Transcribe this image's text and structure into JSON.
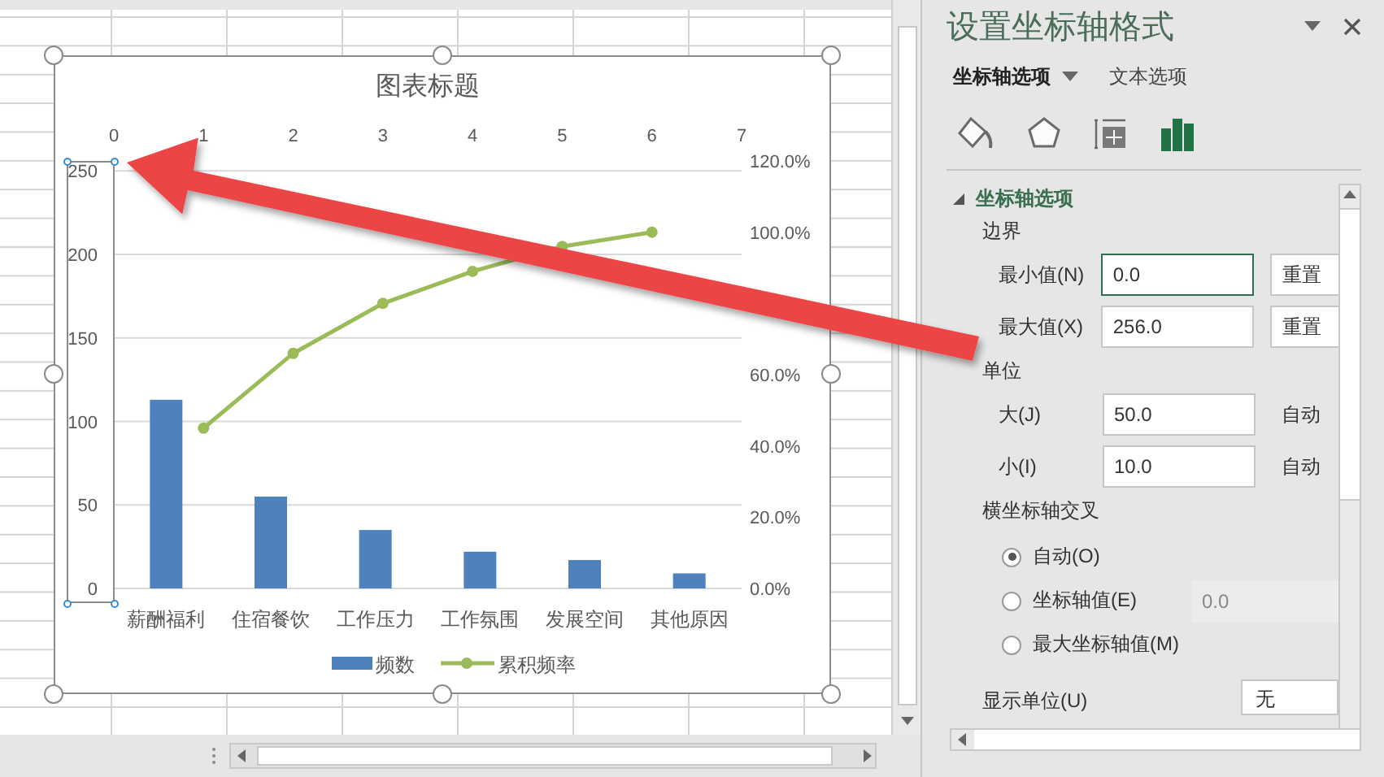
{
  "chart": {
    "bar_chart": {
      "chart_data": {
        "type": "bar",
        "title": "图表标题",
        "categories": [
          "薪酬福利",
          "住宿餐饮",
          "工作压力",
          "工作氛围",
          "发展空间",
          "其他原因"
        ],
        "series": [
          {
            "name": "频数",
            "color": "#4f81bd",
            "values": [
              113,
              55,
              35,
              22,
              17,
              9
            ]
          }
        ],
        "ylim": [
          0,
          256
        ],
        "yticks": [
          0,
          50,
          100,
          150,
          200,
          250
        ],
        "grid": true
      }
    },
    "line_chart": {
      "chart_data": {
        "type": "line",
        "x": [
          1,
          2,
          3,
          4,
          5,
          6
        ],
        "series": [
          {
            "name": "累积频率",
            "color": "#9bbb59",
            "values": [
              0.45,
              0.66,
              0.8,
              0.89,
              0.96,
              1.0
            ],
            "marker": true
          }
        ],
        "xlim": [
          0,
          7
        ],
        "xticks": [
          0,
          1,
          2,
          3,
          4,
          5,
          6,
          7
        ],
        "ylim": [
          0,
          1.2
        ],
        "yticks": [
          {
            "value": 0,
            "label": "0.0%"
          },
          {
            "value": 0.2,
            "label": "20.0%"
          },
          {
            "value": 0.4,
            "label": "40.0%"
          },
          {
            "value": 0.6,
            "label": "60.0%"
          },
          {
            "value": 1.0,
            "label": "100.0%"
          },
          {
            "value": 1.2,
            "label": "120.0%"
          }
        ]
      }
    }
  },
  "panel": {
    "title": "设置坐标轴格式",
    "tabs": [
      {
        "label": "坐标轴选项",
        "selected": true
      },
      {
        "label": "文本选项",
        "selected": false
      }
    ],
    "icon_tabs": [
      {
        "kind": "fill",
        "selected": false
      },
      {
        "kind": "effects",
        "selected": false
      },
      {
        "kind": "size",
        "selected": false
      },
      {
        "kind": "axis",
        "selected": true
      }
    ],
    "section": {
      "title": "坐标轴选项",
      "expanded": true
    },
    "bounds": {
      "heading": "边界",
      "rows": [
        {
          "label": "最小值(N)",
          "value": "0.0",
          "button": "重置",
          "focused": true
        },
        {
          "label": "最大值(X)",
          "value": "256.0",
          "button": "重置",
          "focused": false
        }
      ]
    },
    "units": {
      "heading": "单位",
      "rows": [
        {
          "label": "大(J)",
          "value": "50.0",
          "status": "自动"
        },
        {
          "label": "小(I)",
          "value": "10.0",
          "status": "自动"
        }
      ]
    },
    "crosses": {
      "heading": "横坐标轴交叉",
      "options": [
        {
          "label": "自动(O)",
          "selected": true
        },
        {
          "label": "坐标轴值(E)",
          "selected": false,
          "value": "0.0",
          "disabled": true
        },
        {
          "label": "最大坐标轴值(M)",
          "selected": false
        }
      ]
    },
    "display_units": {
      "label": "显示单位(U)",
      "value": "无"
    }
  }
}
